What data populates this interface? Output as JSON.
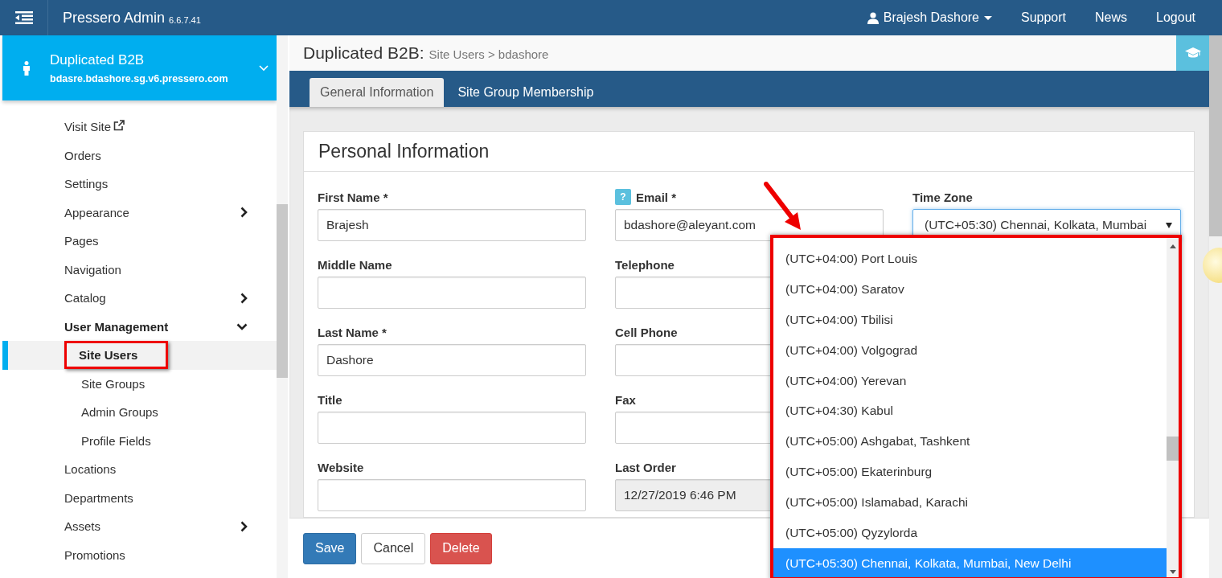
{
  "navbar": {
    "app_name": "Pressero Admin",
    "version": "6.6.7.41",
    "user": "Brajesh Dashore",
    "links": [
      "Support",
      "News",
      "Logout"
    ]
  },
  "site": {
    "name": "Duplicated B2B",
    "domain": "bdasre.bdashore.sg.v6.pressero.com"
  },
  "sidebar": {
    "items": [
      {
        "label": "Visit Site",
        "kind": "external",
        "selected": false
      },
      {
        "label": "Orders",
        "kind": "link",
        "selected": false
      },
      {
        "label": "Settings",
        "kind": "link",
        "selected": false
      },
      {
        "label": "Appearance",
        "kind": "submenu",
        "expanded": false,
        "selected": false
      },
      {
        "label": "Pages",
        "kind": "link",
        "selected": false
      },
      {
        "label": "Navigation",
        "kind": "link",
        "selected": false
      },
      {
        "label": "Catalog",
        "kind": "submenu",
        "expanded": false,
        "selected": false
      },
      {
        "label": "User Management",
        "kind": "submenu",
        "expanded": true,
        "selected": false,
        "children": [
          {
            "label": "Site Users",
            "selected": true,
            "highlighted": true
          },
          {
            "label": "Site Groups",
            "selected": false,
            "highlighted": false
          },
          {
            "label": "Admin Groups",
            "selected": false,
            "highlighted": false
          },
          {
            "label": "Profile Fields",
            "selected": false,
            "highlighted": false
          }
        ]
      },
      {
        "label": "Locations",
        "kind": "link",
        "selected": false
      },
      {
        "label": "Departments",
        "kind": "link",
        "selected": false
      },
      {
        "label": "Assets",
        "kind": "submenu",
        "expanded": false,
        "selected": false
      },
      {
        "label": "Promotions",
        "kind": "link",
        "selected": false
      }
    ]
  },
  "breadcrumb": {
    "title": "Duplicated B2B:",
    "path": "Site Users > bdashore"
  },
  "tabs": [
    {
      "label": "General Information",
      "selected": true
    },
    {
      "label": "Site Group Membership",
      "selected": false
    }
  ],
  "panel": {
    "title": "Personal Information",
    "columns": [
      [
        {
          "label": "First Name *",
          "kind": "text",
          "value": "Brajesh",
          "disabled": false
        },
        {
          "label": "Middle Name",
          "kind": "text",
          "disabled": false
        },
        {
          "label": "Last Name *",
          "kind": "text",
          "value": "Dashore",
          "disabled": false
        },
        {
          "label": "Title",
          "kind": "text",
          "disabled": false
        },
        {
          "label": "Website",
          "kind": "text",
          "disabled": false
        }
      ],
      [
        {
          "label": "Email *",
          "kind": "text",
          "value": "bdashore@aleyant.com",
          "help": "?",
          "disabled": false
        },
        {
          "label": "Telephone",
          "kind": "text",
          "disabled": false
        },
        {
          "label": "Cell Phone",
          "kind": "text",
          "disabled": false
        },
        {
          "label": "Fax",
          "kind": "text",
          "disabled": false
        },
        {
          "label": "Last Order",
          "kind": "text",
          "value": "12/27/2019 6:46 PM",
          "disabled": true
        }
      ],
      [
        {
          "label": "Time Zone",
          "kind": "select",
          "value": "(UTC+05:30) Chennai, Kolkata, Mumbai"
        }
      ]
    ]
  },
  "dropdown": {
    "highlighted": true,
    "options": [
      {
        "label": "(UTC+04:00) Port Louis",
        "selected": false
      },
      {
        "label": "(UTC+04:00) Saratov",
        "selected": false
      },
      {
        "label": "(UTC+04:00) Tbilisi",
        "selected": false
      },
      {
        "label": "(UTC+04:00) Volgograd",
        "selected": false
      },
      {
        "label": "(UTC+04:00) Yerevan",
        "selected": false
      },
      {
        "label": "(UTC+04:30) Kabul",
        "selected": false
      },
      {
        "label": "(UTC+05:00) Ashgabat, Tashkent",
        "selected": false
      },
      {
        "label": "(UTC+05:00) Ekaterinburg",
        "selected": false
      },
      {
        "label": "(UTC+05:00) Islamabad, Karachi",
        "selected": false
      },
      {
        "label": "(UTC+05:00) Qyzylorda",
        "selected": false
      },
      {
        "label": "(UTC+05:30) Chennai, Kolkata, Mumbai, New Delhi",
        "selected": true
      }
    ]
  },
  "buttons": [
    {
      "label": "Save",
      "kind": "primary"
    },
    {
      "label": "Cancel",
      "kind": "default"
    },
    {
      "label": "Delete",
      "kind": "danger"
    }
  ]
}
